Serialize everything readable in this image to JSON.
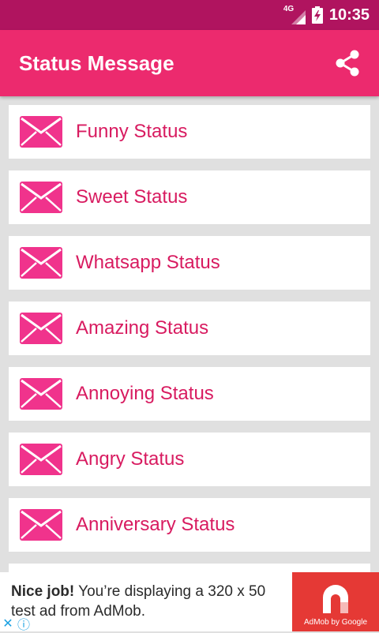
{
  "status_bar": {
    "network": "4G",
    "time": "10:35"
  },
  "app_bar": {
    "title": "Status Message",
    "share_icon": "share-icon"
  },
  "list": {
    "items": [
      {
        "label": "Funny Status",
        "icon": "envelope-icon"
      },
      {
        "label": "Sweet Status",
        "icon": "envelope-icon"
      },
      {
        "label": "Whatsapp Status",
        "icon": "envelope-icon"
      },
      {
        "label": "Amazing Status",
        "icon": "envelope-icon"
      },
      {
        "label": "Annoying Status",
        "icon": "envelope-icon"
      },
      {
        "label": "Angry Status",
        "icon": "envelope-icon"
      },
      {
        "label": "Anniversary Status",
        "icon": "envelope-icon"
      }
    ]
  },
  "ad": {
    "headline": "Nice job!",
    "body": "You’re displaying a 320 x 50 test ad from AdMob.",
    "logo_caption": "AdMob by Google"
  },
  "colors": {
    "status_bar": "#b0145f",
    "app_bar": "#ec2a6e",
    "item_text": "#d81b60",
    "background": "#e0e0e0"
  }
}
